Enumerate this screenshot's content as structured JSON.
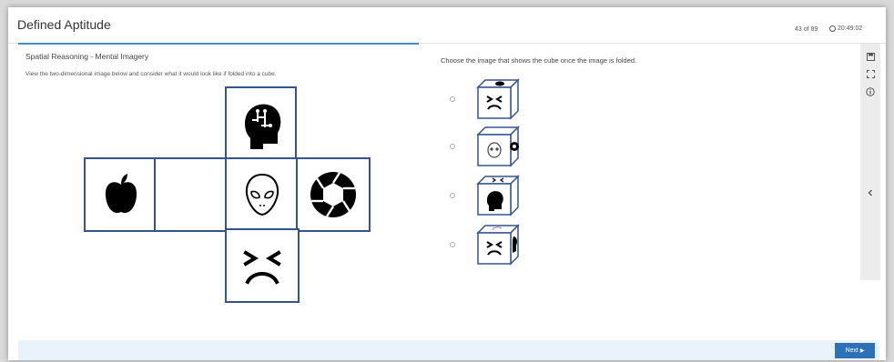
{
  "header": {
    "title": "Defined Aptitude",
    "progress": "43 of 89",
    "timer": "20:49:02"
  },
  "left": {
    "section_title": "Spatial Reasoning - Mental Imagery",
    "instructions": "View the two-dimensional image below and consider what it would look like if folded into a cube."
  },
  "net": {
    "faces": [
      "head-circuit-icon",
      "apple-icon",
      "blank-face",
      "alien-icon",
      "aperture-icon",
      "angry-face-icon"
    ]
  },
  "right": {
    "question": "Choose the image that shows the cube once the image is folded.",
    "options": [
      {
        "front": "angry-face-icon",
        "top": "apple-icon",
        "side": "blank"
      },
      {
        "front": "alien-icon",
        "top": "blank",
        "side": "aperture-icon"
      },
      {
        "front": "head-circuit-icon",
        "top": "angry-face-icon",
        "side": "blank"
      },
      {
        "front": "angry-face-icon",
        "top": "head-circuit-icon",
        "side": "apple-icon"
      }
    ]
  },
  "sidebar": {
    "icons": [
      "save-icon",
      "fullscreen-icon",
      "info-icon",
      "collapse-icon"
    ]
  },
  "footer": {
    "next_label": "Next",
    "next_arrow": "▶"
  },
  "colors": {
    "net_border": "#36528f",
    "accent": "#2d72b9",
    "tab_line": "#4f88c6"
  }
}
